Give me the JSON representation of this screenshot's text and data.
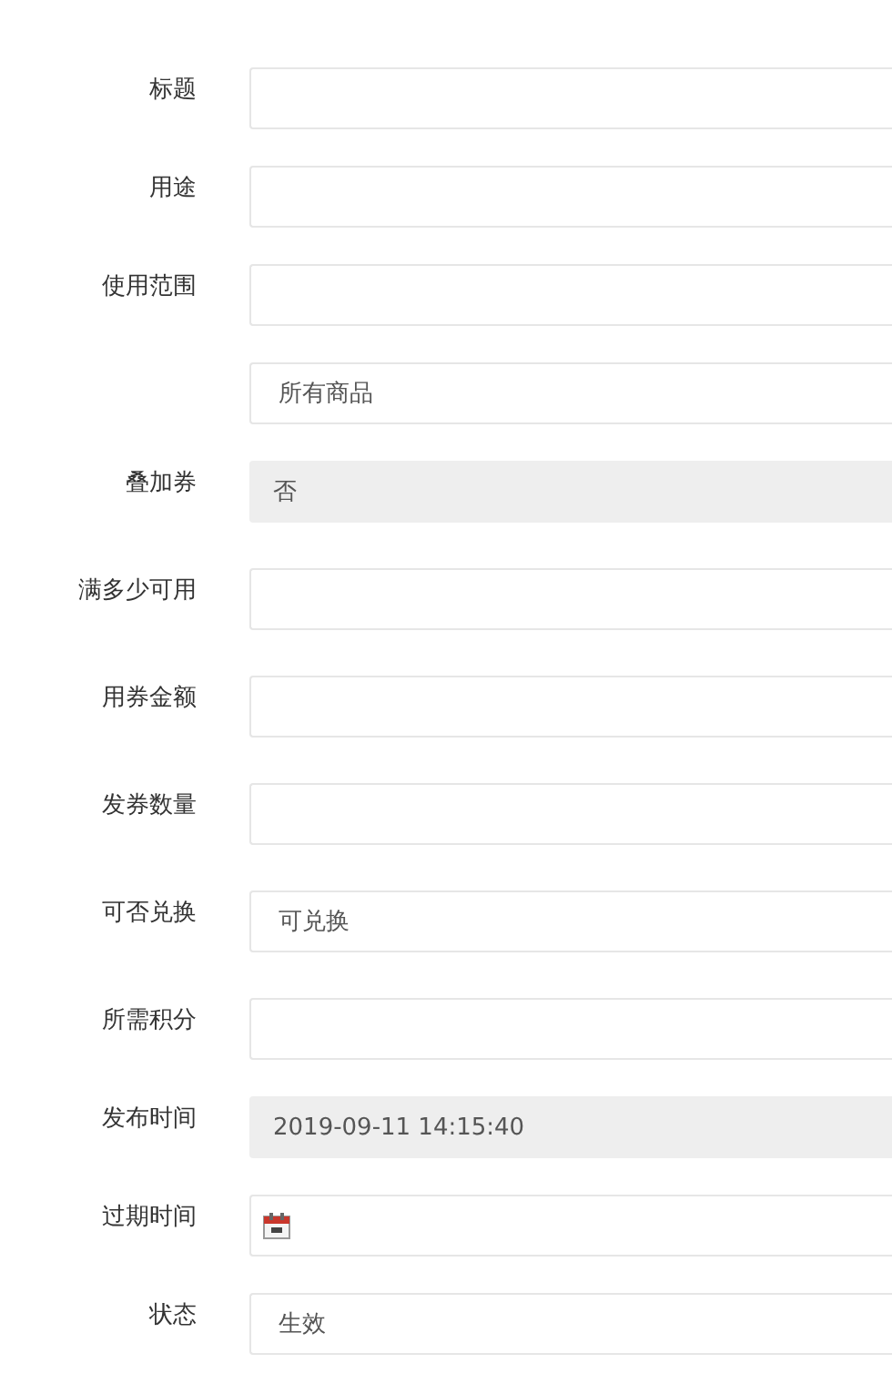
{
  "fields": [
    {
      "kind": "input",
      "label": "标题",
      "disabled": false
    },
    {
      "kind": "input",
      "label": "用途",
      "disabled": false
    },
    {
      "kind": "input",
      "label": "使用范围",
      "disabled": false
    },
    {
      "kind": "input",
      "value": "所有商品",
      "disabled": false
    },
    {
      "kind": "input",
      "label": "叠加券",
      "value": "否",
      "disabled": true
    },
    {
      "kind": "input",
      "label": "满多少可用",
      "disabled": false
    },
    {
      "kind": "input",
      "label": "用券金额",
      "disabled": false
    },
    {
      "kind": "input",
      "label": "发券数量",
      "disabled": false
    },
    {
      "kind": "input",
      "label": "可否兑换",
      "value": "可兑换",
      "disabled": false
    },
    {
      "kind": "input",
      "label": "所需积分",
      "disabled": false
    },
    {
      "kind": "input",
      "label": "发布时间",
      "value": "2019-09-11 14:15:40",
      "disabled": true
    },
    {
      "kind": "date",
      "label": "过期时间",
      "disabled": false
    },
    {
      "kind": "input",
      "label": "状态",
      "value": "生效",
      "disabled": false
    }
  ]
}
